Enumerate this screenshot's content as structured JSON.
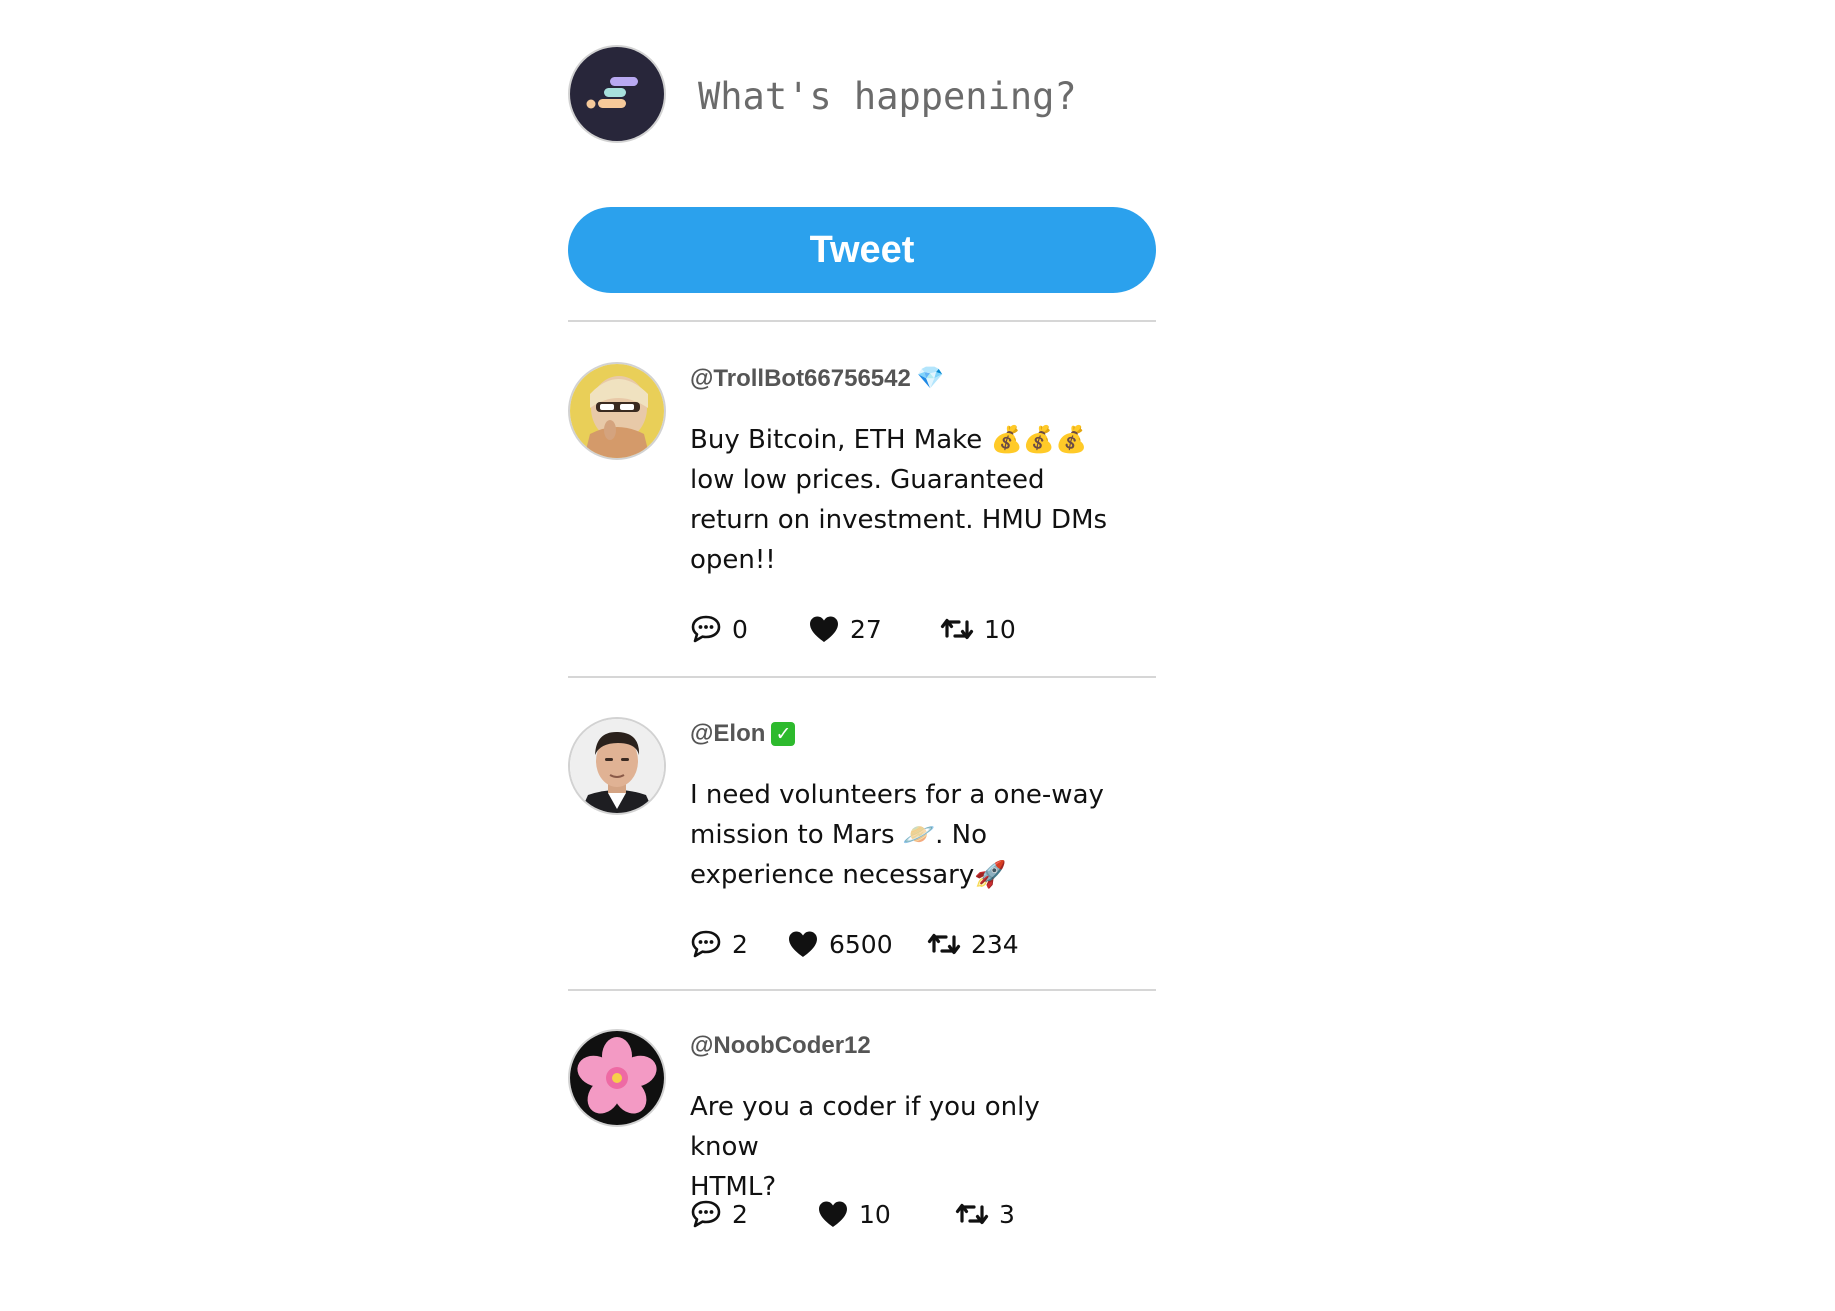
{
  "compose": {
    "placeholder": "What's happening?",
    "tweet_button": "Tweet",
    "avatar_icon": "app-logo-icon"
  },
  "colors": {
    "accent": "#2ba1ed",
    "divider": "#d6d6d6",
    "handle": "#555555"
  },
  "posts": [
    {
      "handle": "@TrollBot66756542",
      "badge_icon": "diamond-icon",
      "badge": "💎",
      "lines": [
        "Buy Bitcoin, ETH Make 💰💰💰",
        "low low prices. Guaranteed",
        "return on investment. HMU DMs",
        "open!!"
      ],
      "comments": "0",
      "likes": "27",
      "retweets": "10"
    },
    {
      "handle": "@Elon",
      "badge_icon": "verified-check-icon",
      "badge": "✓",
      "lines": [
        "I need volunteers for a one-way",
        "mission to Mars 🪐. No",
        "experience necessary🚀"
      ],
      "comments": "2",
      "likes": "6500",
      "retweets": "234"
    },
    {
      "handle": "@NoobCoder12",
      "badge_icon": "",
      "badge": "",
      "lines": [
        "Are you a coder if you only know",
        "HTML?"
      ],
      "comments": "2",
      "likes": "10",
      "retweets": "3"
    }
  ]
}
